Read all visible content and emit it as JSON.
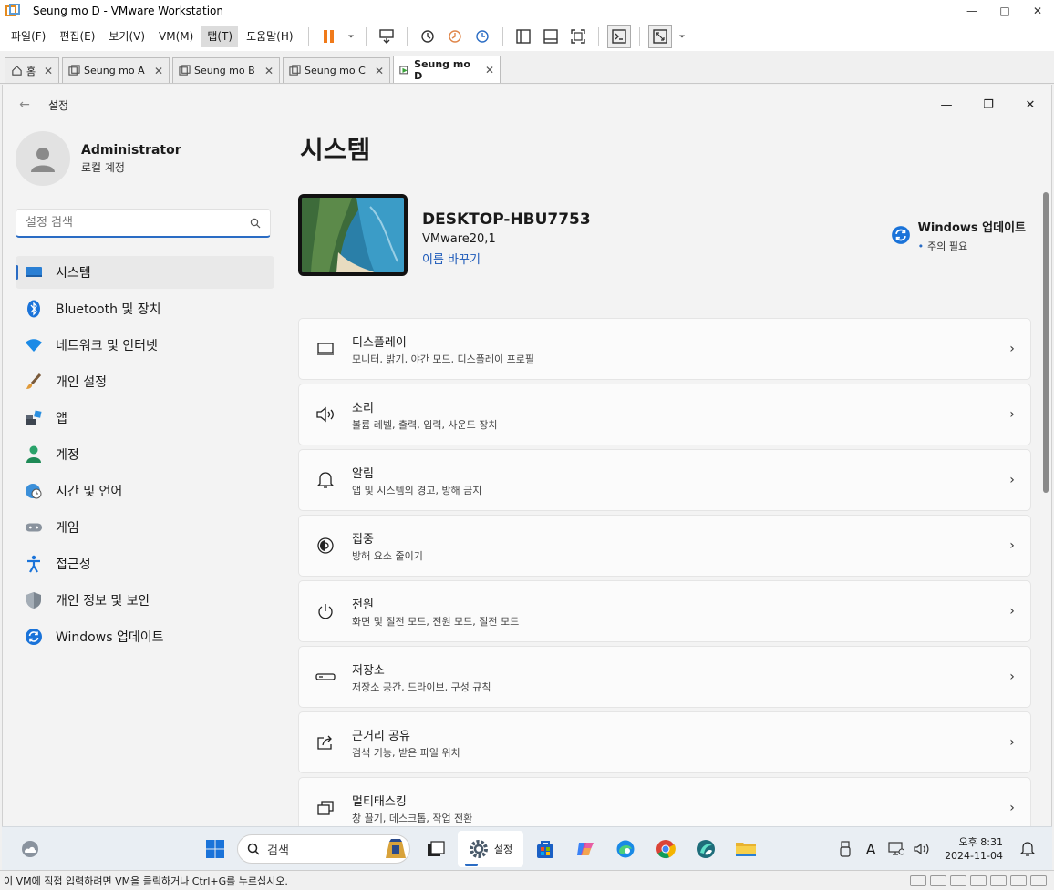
{
  "vmware": {
    "title": "Seung mo D - VMware Workstation",
    "window_controls": [
      "—",
      "□",
      "✕"
    ],
    "menu": [
      "파일(F)",
      "편집(E)",
      "보기(V)",
      "VM(M)",
      "탭(T)",
      "도움말(H)"
    ],
    "tabs": [
      {
        "label": "홈"
      },
      {
        "label": "Seung mo A"
      },
      {
        "label": "Seung mo B"
      },
      {
        "label": "Seung mo C"
      },
      {
        "label": "Seung mo D"
      }
    ],
    "status_text": "이 VM에 직접 입력하려면 VM을 클릭하거나 Ctrl+G를 누르십시오.",
    "colors": {
      "pause": "#f07a1a",
      "accent": "#2a6cc4"
    }
  },
  "settings": {
    "window_label": "설정",
    "window_controls": [
      "—",
      "❐",
      "✕"
    ],
    "profile": {
      "name": "Administrator",
      "type": "로컬 계정"
    },
    "search_placeholder": "설정 검색",
    "nav": [
      {
        "label": "시스템",
        "icon": "monitor-icon"
      },
      {
        "label": "Bluetooth 및 장치",
        "icon": "bluetooth-icon"
      },
      {
        "label": "네트워크 및 인터넷",
        "icon": "wifi-icon"
      },
      {
        "label": "개인 설정",
        "icon": "brush-icon"
      },
      {
        "label": "앱",
        "icon": "apps-icon"
      },
      {
        "label": "계정",
        "icon": "person-icon"
      },
      {
        "label": "시간 및 언어",
        "icon": "globe-clock-icon"
      },
      {
        "label": "게임",
        "icon": "gamepad-icon"
      },
      {
        "label": "접근성",
        "icon": "accessibility-icon"
      },
      {
        "label": "개인 정보 및 보안",
        "icon": "shield-icon"
      },
      {
        "label": "Windows 업데이트",
        "icon": "update-icon"
      }
    ],
    "page_title": "시스템",
    "device": {
      "name": "DESKTOP-HBU7753",
      "model": "VMware20,1",
      "rename": "이름 바꾸기"
    },
    "update": {
      "title": "Windows 업데이트",
      "status": "주의 필요"
    },
    "cards": [
      {
        "title": "디스플레이",
        "subtitle": "모니터, 밝기, 야간 모드, 디스플레이 프로필",
        "icon": "display-icon"
      },
      {
        "title": "소리",
        "subtitle": "볼륨 레벨, 출력, 입력, 사운드 장치",
        "icon": "speaker-icon"
      },
      {
        "title": "알림",
        "subtitle": "앱 및 시스템의 경고, 방해 금지",
        "icon": "bell-icon"
      },
      {
        "title": "집중",
        "subtitle": "방해 요소 줄이기",
        "icon": "focus-icon"
      },
      {
        "title": "전원",
        "subtitle": "화면 및 절전 모드, 전원 모드, 절전 모드",
        "icon": "power-icon"
      },
      {
        "title": "저장소",
        "subtitle": "저장소 공간, 드라이브, 구성 규칙",
        "icon": "storage-icon"
      },
      {
        "title": "근거리 공유",
        "subtitle": "검색 기능, 받은 파일 위치",
        "icon": "share-icon"
      },
      {
        "title": "멀티태스킹",
        "subtitle": "창 끌기, 데스크톱, 작업 전환",
        "icon": "multitask-icon"
      }
    ]
  },
  "taskbar": {
    "search_text": "검색",
    "settings_app_label": "설정",
    "clock_time": "오후 8:31",
    "clock_date": "2024-11-04"
  }
}
